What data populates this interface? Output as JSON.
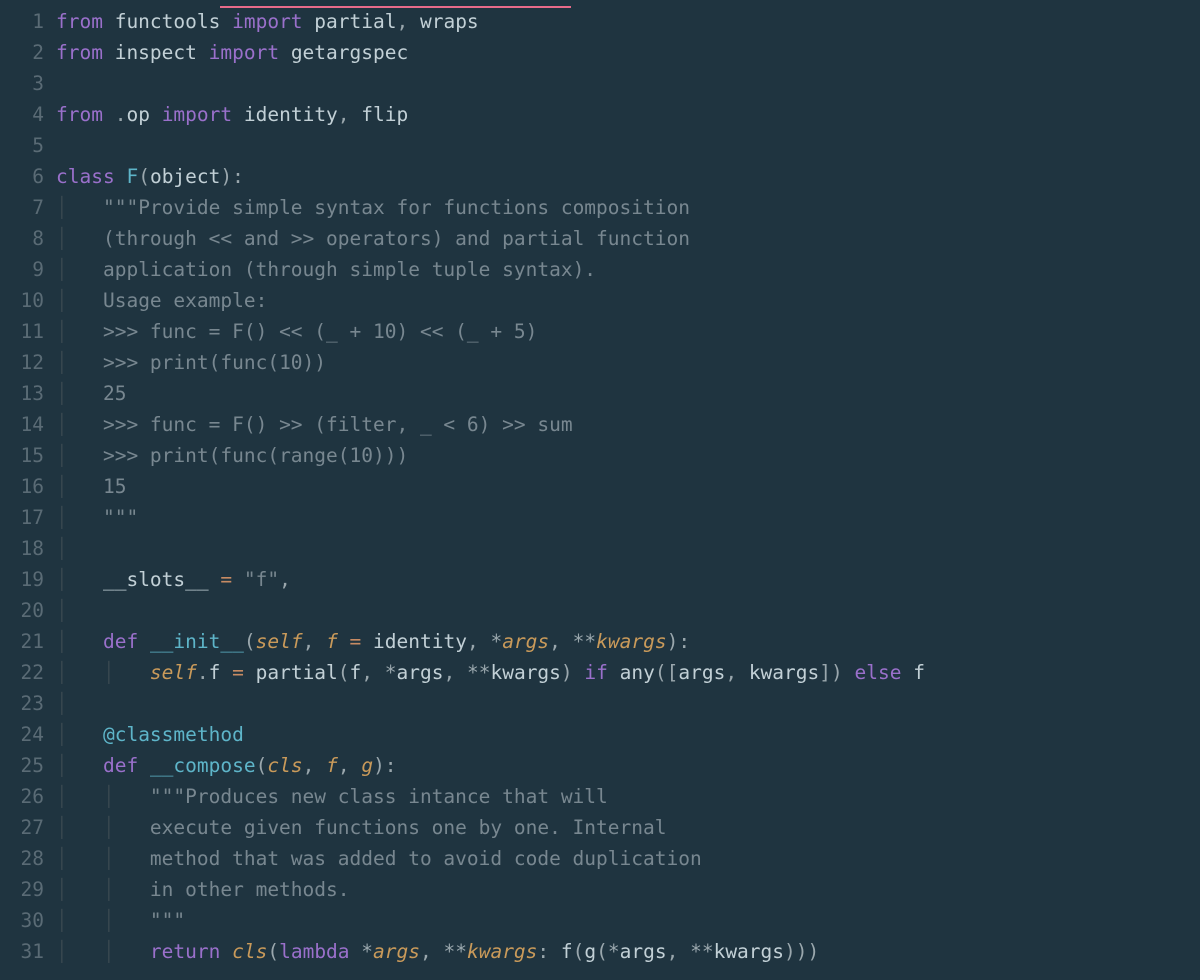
{
  "colors": {
    "background": "#1f3440",
    "gutter_fg": "#5a6b75",
    "default": "#c2d0d6",
    "keyword": "#9a70cb",
    "func": "#5eb5c9",
    "string": "#788790",
    "literal": "#c78b63",
    "self": "#c99a5a",
    "punct": "#9aa7ad",
    "guide": "#37474f",
    "underline": "#e86b8a"
  },
  "line_numbers": [
    "1",
    "2",
    "3",
    "4",
    "5",
    "6",
    "7",
    "8",
    "9",
    "10",
    "11",
    "12",
    "13",
    "14",
    "15",
    "16",
    "17",
    "18",
    "19",
    "20",
    "21",
    "22",
    "23",
    "24",
    "25",
    "26",
    "27",
    "28",
    "29",
    "30",
    "31"
  ],
  "underline": {
    "line": 1,
    "col_start": 14,
    "col_end": 44
  },
  "lines": [
    [
      {
        "t": "from ",
        "c": "kw"
      },
      {
        "t": "functools ",
        "c": "id"
      },
      {
        "t": "import ",
        "c": "kw"
      },
      {
        "t": "partial",
        "c": "id"
      },
      {
        "t": ", ",
        "c": "punct"
      },
      {
        "t": "wraps",
        "c": "id"
      }
    ],
    [
      {
        "t": "from ",
        "c": "kw"
      },
      {
        "t": "inspect ",
        "c": "id"
      },
      {
        "t": "import ",
        "c": "kw"
      },
      {
        "t": "getargspec",
        "c": "id"
      }
    ],
    [],
    [
      {
        "t": "from ",
        "c": "kw"
      },
      {
        "t": ".",
        "c": "punct"
      },
      {
        "t": "op ",
        "c": "id"
      },
      {
        "t": "import ",
        "c": "kw"
      },
      {
        "t": "identity",
        "c": "id"
      },
      {
        "t": ", ",
        "c": "punct"
      },
      {
        "t": "flip",
        "c": "id"
      }
    ],
    [],
    [
      {
        "t": "class ",
        "c": "kw"
      },
      {
        "t": "F",
        "c": "fn"
      },
      {
        "t": "(",
        "c": "punct"
      },
      {
        "t": "object",
        "c": "id"
      },
      {
        "t": "):",
        "c": "punct"
      }
    ],
    [
      {
        "t": "│   ",
        "c": "guide"
      },
      {
        "t": "\"\"\"Provide simple syntax for functions composition",
        "c": "str"
      }
    ],
    [
      {
        "t": "│   ",
        "c": "guide"
      },
      {
        "t": "(through << and >> operators) and partial function",
        "c": "str"
      }
    ],
    [
      {
        "t": "│   ",
        "c": "guide"
      },
      {
        "t": "application (through simple tuple syntax).",
        "c": "str"
      }
    ],
    [
      {
        "t": "│   ",
        "c": "guide"
      },
      {
        "t": "Usage example:",
        "c": "str"
      }
    ],
    [
      {
        "t": "│   ",
        "c": "guide"
      },
      {
        "t": ">>> func = F() << (_ + 10) << (_ + 5)",
        "c": "str"
      }
    ],
    [
      {
        "t": "│   ",
        "c": "guide"
      },
      {
        "t": ">>> print(func(10))",
        "c": "str"
      }
    ],
    [
      {
        "t": "│   ",
        "c": "guide"
      },
      {
        "t": "25",
        "c": "str"
      }
    ],
    [
      {
        "t": "│   ",
        "c": "guide"
      },
      {
        "t": ">>> func = F() >> (filter, _ < 6) >> sum",
        "c": "str"
      }
    ],
    [
      {
        "t": "│   ",
        "c": "guide"
      },
      {
        "t": ">>> print(func(range(10)))",
        "c": "str"
      }
    ],
    [
      {
        "t": "│   ",
        "c": "guide"
      },
      {
        "t": "15",
        "c": "str"
      }
    ],
    [
      {
        "t": "│   ",
        "c": "guide"
      },
      {
        "t": "\"\"\"",
        "c": "str"
      }
    ],
    [
      {
        "t": "│",
        "c": "guide"
      }
    ],
    [
      {
        "t": "│   ",
        "c": "guide"
      },
      {
        "t": "__slots__",
        "c": "id"
      },
      {
        "t": " = ",
        "c": "op"
      },
      {
        "t": "\"f\"",
        "c": "str"
      },
      {
        "t": ",",
        "c": "punct"
      }
    ],
    [
      {
        "t": "│",
        "c": "guide"
      }
    ],
    [
      {
        "t": "│   ",
        "c": "guide"
      },
      {
        "t": "def ",
        "c": "kw"
      },
      {
        "t": "__init__",
        "c": "fn"
      },
      {
        "t": "(",
        "c": "punct"
      },
      {
        "t": "self",
        "c": "self"
      },
      {
        "t": ", ",
        "c": "punct"
      },
      {
        "t": "f",
        "c": "param"
      },
      {
        "t": " = ",
        "c": "op"
      },
      {
        "t": "identity",
        "c": "id"
      },
      {
        "t": ", *",
        "c": "punct"
      },
      {
        "t": "args",
        "c": "param"
      },
      {
        "t": ", **",
        "c": "punct"
      },
      {
        "t": "kwargs",
        "c": "param"
      },
      {
        "t": "):",
        "c": "punct"
      }
    ],
    [
      {
        "t": "│   │   ",
        "c": "guide"
      },
      {
        "t": "self",
        "c": "self"
      },
      {
        "t": ".",
        "c": "punct"
      },
      {
        "t": "f ",
        "c": "id"
      },
      {
        "t": "= ",
        "c": "op"
      },
      {
        "t": "partial",
        "c": "id"
      },
      {
        "t": "(",
        "c": "punct"
      },
      {
        "t": "f",
        "c": "id"
      },
      {
        "t": ", *",
        "c": "punct"
      },
      {
        "t": "args",
        "c": "id"
      },
      {
        "t": ", **",
        "c": "punct"
      },
      {
        "t": "kwargs",
        "c": "id"
      },
      {
        "t": ") ",
        "c": "punct"
      },
      {
        "t": "if ",
        "c": "kw"
      },
      {
        "t": "any",
        "c": "id"
      },
      {
        "t": "([",
        "c": "punct"
      },
      {
        "t": "args",
        "c": "id"
      },
      {
        "t": ", ",
        "c": "punct"
      },
      {
        "t": "kwargs",
        "c": "id"
      },
      {
        "t": "]) ",
        "c": "punct"
      },
      {
        "t": "else ",
        "c": "kw"
      },
      {
        "t": "f",
        "c": "id"
      }
    ],
    [
      {
        "t": "│",
        "c": "guide"
      }
    ],
    [
      {
        "t": "│   ",
        "c": "guide"
      },
      {
        "t": "@classmethod",
        "c": "decor"
      }
    ],
    [
      {
        "t": "│   ",
        "c": "guide"
      },
      {
        "t": "def ",
        "c": "kw"
      },
      {
        "t": "__compose",
        "c": "fn"
      },
      {
        "t": "(",
        "c": "punct"
      },
      {
        "t": "cls",
        "c": "self"
      },
      {
        "t": ", ",
        "c": "punct"
      },
      {
        "t": "f",
        "c": "param"
      },
      {
        "t": ", ",
        "c": "punct"
      },
      {
        "t": "g",
        "c": "param"
      },
      {
        "t": "):",
        "c": "punct"
      }
    ],
    [
      {
        "t": "│   │   ",
        "c": "guide"
      },
      {
        "t": "\"\"\"Produces new class intance that will",
        "c": "str"
      }
    ],
    [
      {
        "t": "│   │   ",
        "c": "guide"
      },
      {
        "t": "execute given functions one by one. Internal",
        "c": "str"
      }
    ],
    [
      {
        "t": "│   │   ",
        "c": "guide"
      },
      {
        "t": "method that was added to avoid code duplication",
        "c": "str"
      }
    ],
    [
      {
        "t": "│   │   ",
        "c": "guide"
      },
      {
        "t": "in other methods.",
        "c": "str"
      }
    ],
    [
      {
        "t": "│   │   ",
        "c": "guide"
      },
      {
        "t": "\"\"\"",
        "c": "str"
      }
    ],
    [
      {
        "t": "│   │   ",
        "c": "guide"
      },
      {
        "t": "return ",
        "c": "kw"
      },
      {
        "t": "cls",
        "c": "self"
      },
      {
        "t": "(",
        "c": "punct"
      },
      {
        "t": "lambda ",
        "c": "kw"
      },
      {
        "t": "*",
        "c": "punct"
      },
      {
        "t": "args",
        "c": "param"
      },
      {
        "t": ", **",
        "c": "punct"
      },
      {
        "t": "kwargs",
        "c": "param"
      },
      {
        "t": ": ",
        "c": "punct"
      },
      {
        "t": "f",
        "c": "id"
      },
      {
        "t": "(",
        "c": "punct"
      },
      {
        "t": "g",
        "c": "id"
      },
      {
        "t": "(*",
        "c": "punct"
      },
      {
        "t": "args",
        "c": "id"
      },
      {
        "t": ", **",
        "c": "punct"
      },
      {
        "t": "kwargs",
        "c": "id"
      },
      {
        "t": ")))",
        "c": "punct"
      }
    ]
  ]
}
